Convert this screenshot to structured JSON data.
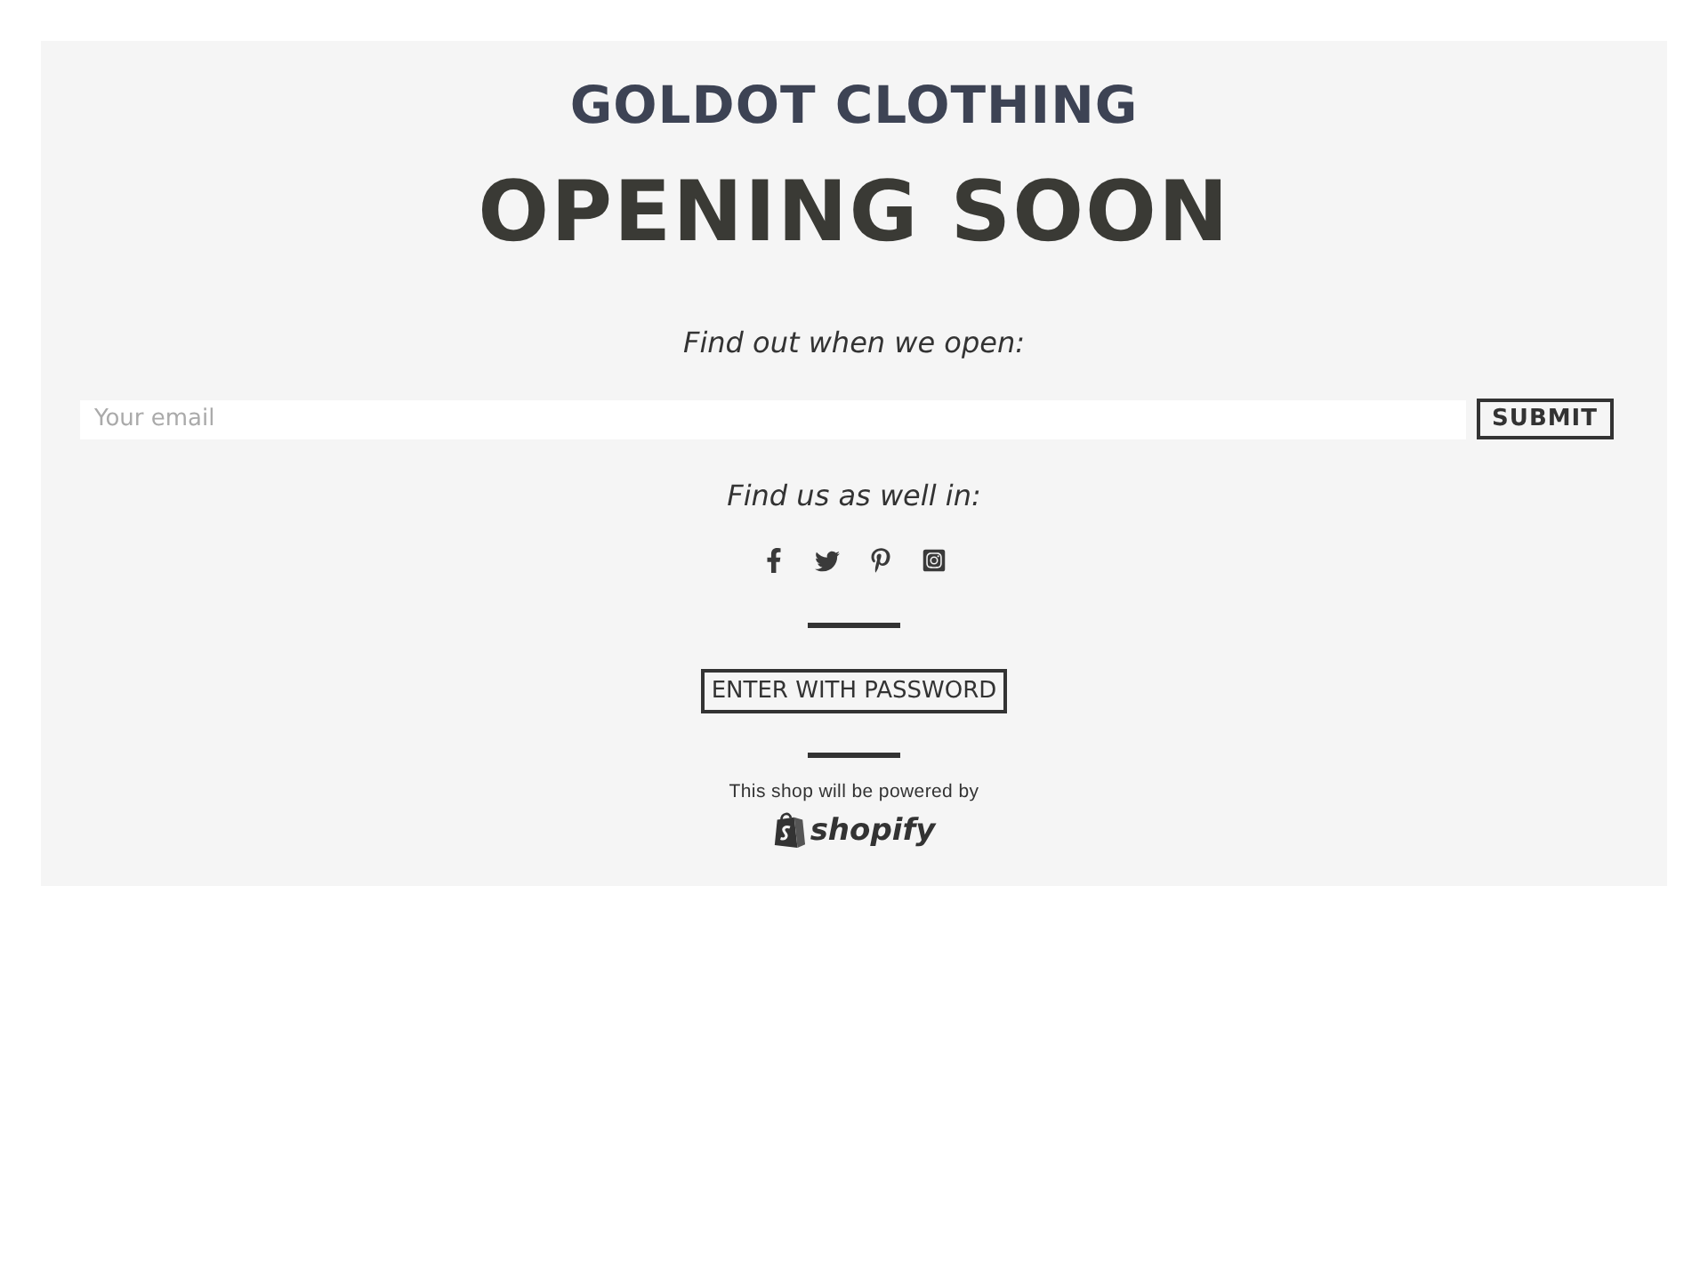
{
  "store": {
    "name": "GOLDOT CLOTHING"
  },
  "headline": "OPENING SOON",
  "signup": {
    "prompt": "Find out when we open:",
    "email": {
      "placeholder": "Your email"
    },
    "submit": "SUBMIT"
  },
  "social": {
    "prompt": "Find us as well in:",
    "links": [
      {
        "kind": "facebook"
      },
      {
        "kind": "twitter"
      },
      {
        "kind": "pinterest"
      },
      {
        "kind": "instagram"
      }
    ]
  },
  "password_button": "ENTER WITH PASSWORD",
  "footer": {
    "note": "This shop will be powered by",
    "logo_text": "shopify"
  }
}
